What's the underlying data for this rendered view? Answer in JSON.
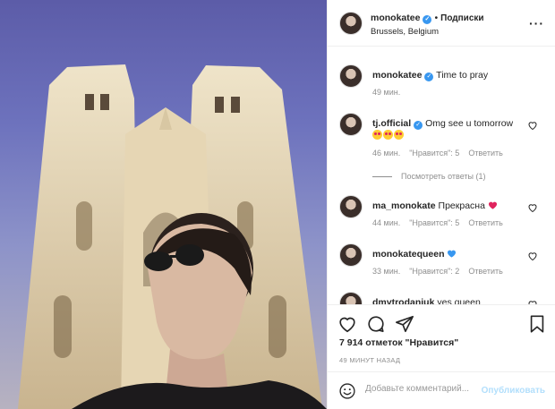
{
  "header": {
    "username": "monokatee",
    "separator": "•",
    "follow_label": "Подписки",
    "location": "Brussels, Belgium",
    "more_icon": "more-horizontal-icon"
  },
  "comments": [
    {
      "user": "monokatee",
      "verified": true,
      "text": "Time to pray",
      "time": "49 мин."
    },
    {
      "user": "tj.official",
      "verified": true,
      "text": "Omg see u tomorrow",
      "time": "46 мин.",
      "likes": "\"Нравится\": 5",
      "reply": "Ответить",
      "view_replies": "Посмотреть ответы (1)"
    },
    {
      "user": "ma_monokate",
      "text": "Прекрасна",
      "time": "44 мин.",
      "likes": "\"Нравится\": 5",
      "reply": "Ответить"
    },
    {
      "user": "monokatequeen",
      "text": "",
      "time": "33 мин.",
      "likes": "\"Нравится\": 2",
      "reply": "Ответить"
    },
    {
      "user": "dmytrodaniuk",
      "text": "yes queen"
    }
  ],
  "footer": {
    "likes": "7 914 отметок \"Нравится\"",
    "time": "49 МИНУТ НАЗАД",
    "comment_placeholder": "Добавьте комментарий...",
    "publish_label": "Опубликовать"
  },
  "colors": {
    "verified": "#3897f0",
    "link": "#b2dffc",
    "meta": "#8e8e8e",
    "heart_red": "#e0245e",
    "heart_blue": "#3897f0"
  }
}
